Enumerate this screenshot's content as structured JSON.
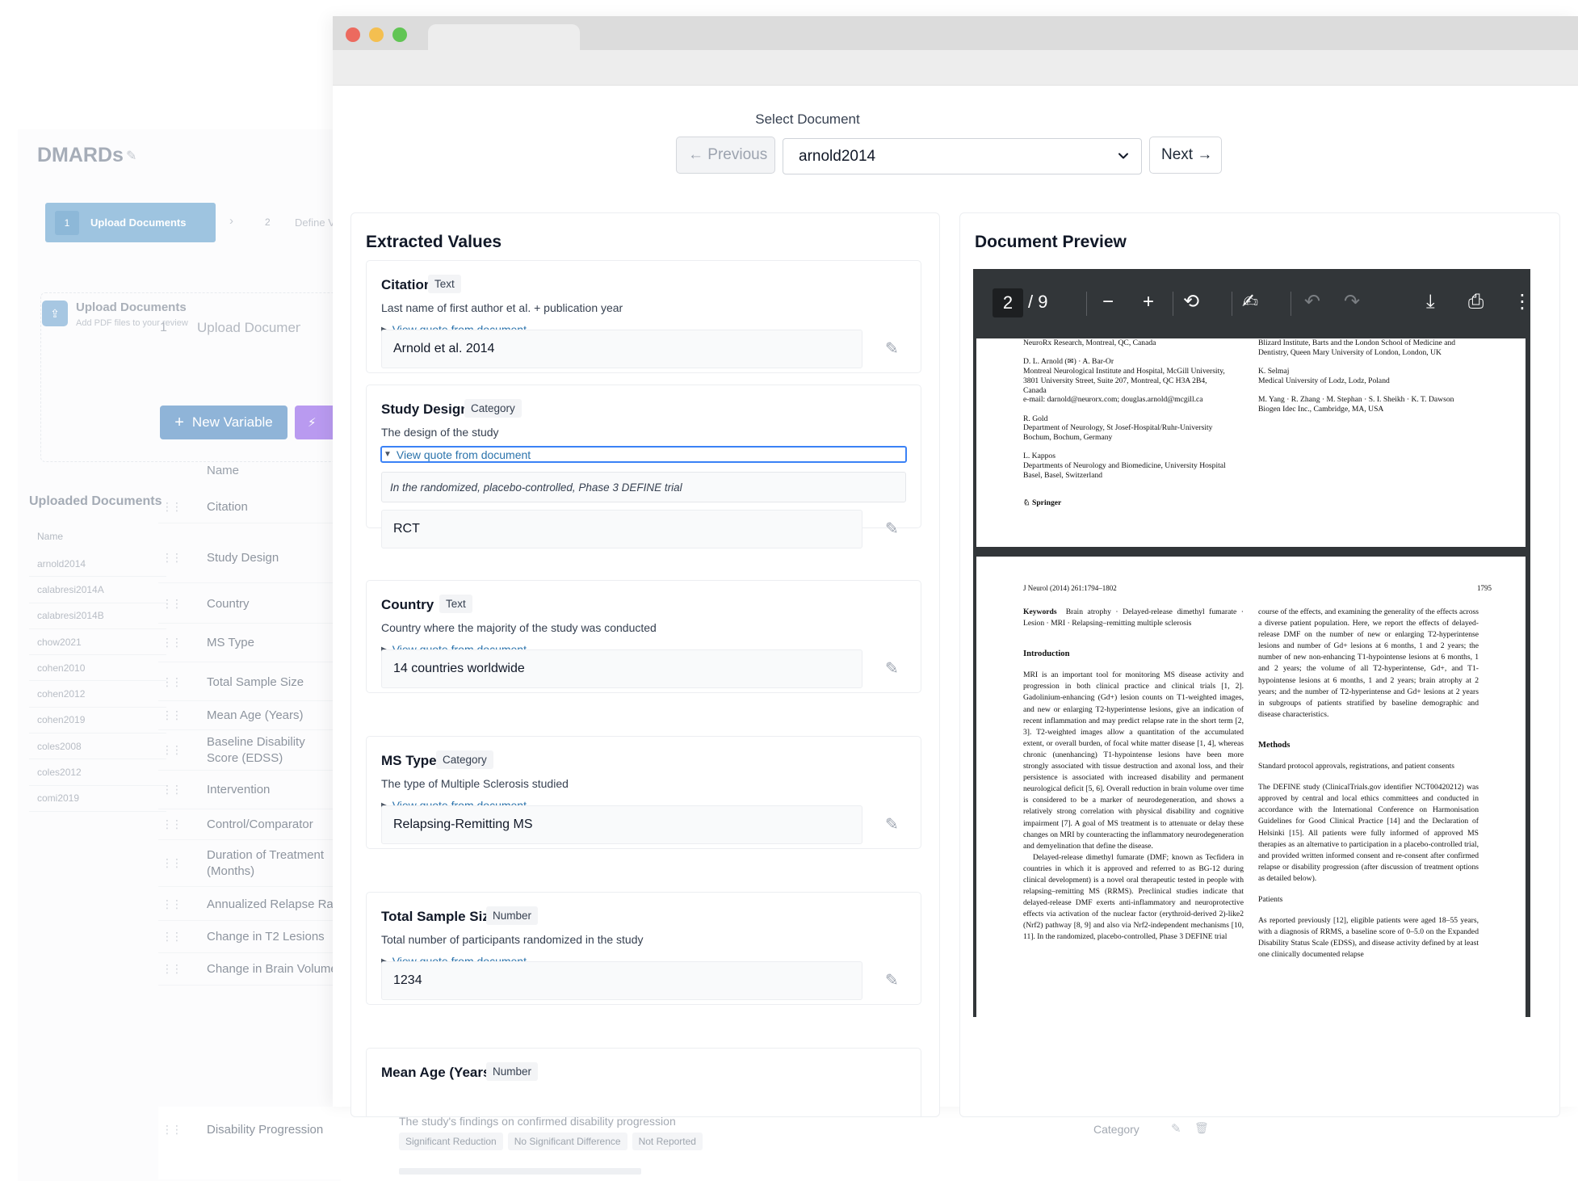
{
  "background_app": {
    "project_title": "DMARDs",
    "steps": [
      {
        "num": "1",
        "label": "Upload Documents"
      },
      {
        "num": "2",
        "label": "Define Variables"
      }
    ],
    "upload_title": "Upload Documents",
    "upload_subtitle": "Add PDF files to your review",
    "mid_step_num": "1",
    "mid_step_label": "Upload Documents",
    "new_variable_label": "New Variable",
    "name_column": "Name",
    "uploaded_documents_title": "Uploaded Documents",
    "uploaded_name_column": "Name",
    "documents": [
      "arnold2014",
      "calabresi2014A",
      "calabresi2014B",
      "chow2021",
      "cohen2010",
      "cohen2012",
      "cohen2019",
      "coles2008",
      "coles2012",
      "comi2019"
    ],
    "variables": [
      "Citation",
      "Study Design",
      "Country",
      "MS Type",
      "Total Sample Size",
      "Mean Age (Years)",
      "Baseline Disability Score (EDSS)",
      "Intervention",
      "Control/Comparator",
      "Duration of Treatment (Months)",
      "Annualized Relapse Rate",
      "Change in T2 Lesions",
      "Change in Brain Volume"
    ],
    "bottom_row": {
      "name": "Disability Progression",
      "description": "The study's findings on confirmed disability progression",
      "options": [
        "Significant Reduction",
        "No Significant Difference",
        "Not Reported"
      ],
      "type": "Category"
    }
  },
  "selector": {
    "label": "Select Document",
    "previous_label": "← Previous",
    "next_label": "Next →",
    "selected_document": "arnold2014"
  },
  "extracted": {
    "title": "Extracted Values",
    "quote_link": "View quote from document",
    "fields": [
      {
        "name": "Citation",
        "type": "Text",
        "description": "Last name of first author et al. + publication year",
        "value": "Arnold et al. 2014"
      },
      {
        "name": "Study Design",
        "type": "Category",
        "description": "The design of the study",
        "quote": "In the randomized, placebo-controlled, Phase 3 DEFINE trial",
        "value": "RCT"
      },
      {
        "name": "Country",
        "type": "Text",
        "description": "Country where the majority of the study was conducted",
        "value": "14 countries worldwide"
      },
      {
        "name": "MS Type",
        "type": "Category",
        "description": "The type of Multiple Sclerosis studied",
        "value": "Relapsing-Remitting MS"
      },
      {
        "name": "Total Sample Size",
        "type": "Number",
        "description": "Total number of participants randomized in the study",
        "value": "1234"
      },
      {
        "name": "Mean Age (Years)",
        "type": "Number"
      }
    ]
  },
  "preview": {
    "title": "Document Preview",
    "current_page": "2",
    "total_pages": "/ 9",
    "page1": {
      "left": [
        "NeuroRx Research, Montreal, QC, Canada",
        "",
        "D. L. Arnold (✉) · A. Bar-Or",
        "Montreal Neurological Institute and Hospital, McGill University,",
        "3801 University Street, Suite 207, Montreal, QC H3A 2B4,",
        "Canada",
        "e-mail: darnold@neurorx.com; douglas.arnold@mcgill.ca",
        "",
        "R. Gold",
        "Department of Neurology, St Josef-Hospital/Ruhr-University",
        "Bochum, Bochum, Germany",
        "",
        "L. Kappos",
        "Departments of Neurology and Biomedicine, University Hospital",
        "Basel, Basel, Switzerland"
      ],
      "right": [
        "Blizard Institute, Barts and the London School of Medicine and",
        "Dentistry, Queen Mary University of London, London, UK",
        "",
        "K. Selmaj",
        "Medical University of Lodz, Lodz, Poland",
        "",
        "M. Yang · R. Zhang · M. Stephan · S. I. Sheikh · K. T. Dawson",
        "Biogen Idec Inc., Cambridge, MA, USA"
      ],
      "publisher": "Springer"
    },
    "page2": {
      "running_head": "J Neurol (2014) 261:1794–1802",
      "page_number": "1795",
      "keywords_label": "Keywords",
      "keywords": "Brain atrophy · Delayed-release dimethyl fumarate · Lesion · MRI · Relapsing–remitting multiple sclerosis",
      "intro_heading": "Introduction",
      "intro_p1": "MRI is an important tool for monitoring MS disease activity and progression in both clinical practice and clinical trials [1, 2]. Gadolinium-enhancing (Gd+) lesion counts on T1-weighted images, and new or enlarging T2-hyperintense lesions, give an indication of recent inflammation and may predict relapse rate in the short term [2, 3]. T2-weighted images allow a quantitation of the accumulated extent, or overall burden, of focal white matter disease [1, 4], whereas chronic (unenhancing) T1-hypointense lesions have been more strongly associated with tissue destruction and axonal loss, and their persistence is associated with increased disability and permanent neurological deficit [5, 6]. Overall reduction in brain volume over time is considered to be a marker of neurodegeneration, and shows a relatively strong correlation with physical disability and cognitive impairment [7]. A goal of MS treatment is to attenuate or delay these changes on MRI by counteracting the inflammatory neurodegeneration and demyelination that define the disease.",
      "intro_p2": "Delayed-release dimethyl fumarate (DMF; known as Tecfidera in countries in which it is approved and referred to as BG-12 during clinical development) is a novel oral therapeutic tested in people with relapsing–remitting MS (RRMS). Preclinical studies indicate that delayed-release DMF exerts anti-inflammatory and neuroprotective effects via activation of the nuclear factor (erythroid-derived 2)-like2 (Nrf2) pathway [8, 9] and also via Nrf2-independent mechanisms [10, 11]. In the randomized, placebo-controlled, Phase 3 DEFINE trial",
      "right_p1": "course of the effects, and examining the generality of the effects across a diverse patient population. Here, we report the effects of delayed-release DMF on the number of new or enlarging T2-hyperintense lesions and number of Gd+ lesions at 6 months, 1 and 2 years; the number of new non-enhancing T1-hypointense lesions at 6 months, 1 and 2 years; the volume of all T2-hyperintense, Gd+, and T1-hypointense lesions at 6 months, 1 and 2 years; brain atrophy at 2 years; and the number of T2-hyperintense and Gd+ lesions at 2 years in subgroups of patients stratified by baseline demographic and disease characteristics.",
      "methods_heading": "Methods",
      "methods_sub": "Standard protocol approvals, registrations, and patient consents",
      "methods_p": "The DEFINE study (ClinicalTrials.gov identifier NCT00420212) was approved by central and local ethics committees and conducted in accordance with the International Conference on Harmonisation Guidelines for Good Clinical Practice [14] and the Declaration of Helsinki [15]. All patients were fully informed of approved MS therapies as an alternative to participation in a placebo-controlled trial, and provided written informed consent and re-consent after confirmed relapse or disability progression (after discussion of treatment options as detailed below).",
      "patients_sub": "Patients",
      "patients_p": "As reported previously [12], eligible patients were aged 18–55 years, with a diagnosis of RRMS, a baseline score of 0–5.0 on the Expanded Disability Status Scale (EDSS), and disease activity defined by at least one clinically documented relapse"
    }
  }
}
